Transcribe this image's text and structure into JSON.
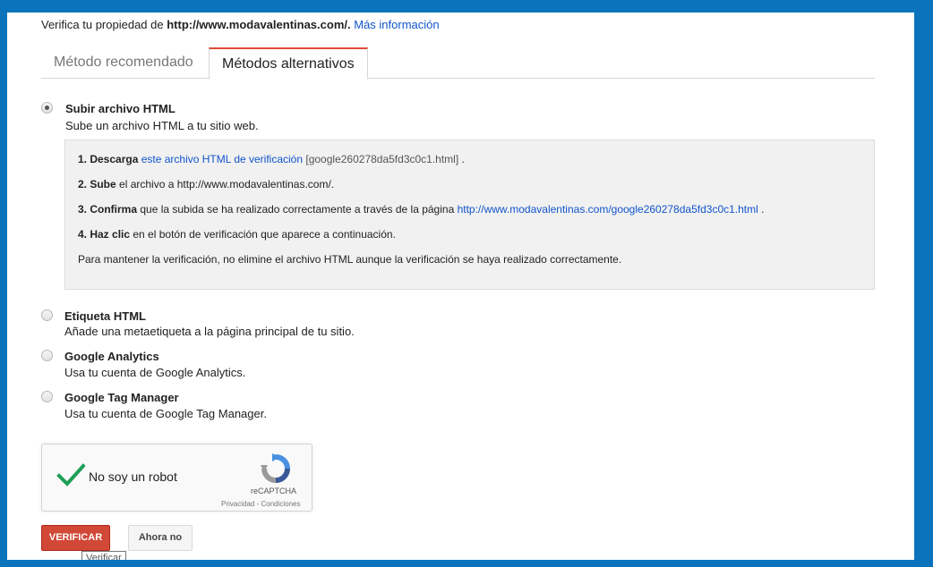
{
  "header": {
    "prefix": "Verifica tu propiedad de ",
    "site": "http://www.modavalentinas.com/.",
    "more_info": "Más información"
  },
  "tabs": [
    {
      "label": "Método recomendado"
    },
    {
      "label": "Métodos alternativos"
    }
  ],
  "methods": [
    {
      "title": "Subir archivo HTML",
      "desc": "Sube un archivo HTML a tu sitio web.",
      "selected": true
    },
    {
      "title": "Etiqueta HTML",
      "desc": "Añade una metaetiqueta a la página principal de tu sitio.",
      "selected": false
    },
    {
      "title": "Google Analytics",
      "desc": "Usa tu cuenta de Google Analytics.",
      "selected": false
    },
    {
      "title": "Google Tag Manager",
      "desc": "Usa tu cuenta de Google Tag Manager.",
      "selected": false
    }
  ],
  "steps": {
    "s1_bold": "1. Descarga",
    "s1_link": "este archivo HTML de verificación",
    "s1_file": "[google260278da5fd3c0c1.html]",
    "s1_end": " .",
    "s2_bold": "2. Sube",
    "s2_text": " el archivo a http://www.modavalentinas.com/.",
    "s3_bold": "3. Confirma",
    "s3_text": " que la subida se ha realizado correctamente a través de la página ",
    "s3_link": "http://www.modavalentinas.com/google260278da5fd3c0c1.html",
    "s3_end": " .",
    "s4_bold": "4. Haz clic",
    "s4_text": " en el botón de verificación que aparece a continuación.",
    "note": "Para mantener la verificación, no elimine el archivo HTML aunque la verificación se haya realizado correctamente."
  },
  "captcha": {
    "label": "No soy un robot",
    "brand": "reCAPTCHA",
    "privacy": "Privacidad",
    "separator": " - ",
    "terms": "Condiciones",
    "check_color": "#1e9e57"
  },
  "buttons": {
    "verify": "VERIFICAR",
    "later": "Ahora no"
  },
  "tooltip": "Verificar",
  "colors": {
    "background": "#0a73bb",
    "link": "#1155cc",
    "verify_button": "#d14836",
    "active_tab_accent": "#dd4b39"
  }
}
